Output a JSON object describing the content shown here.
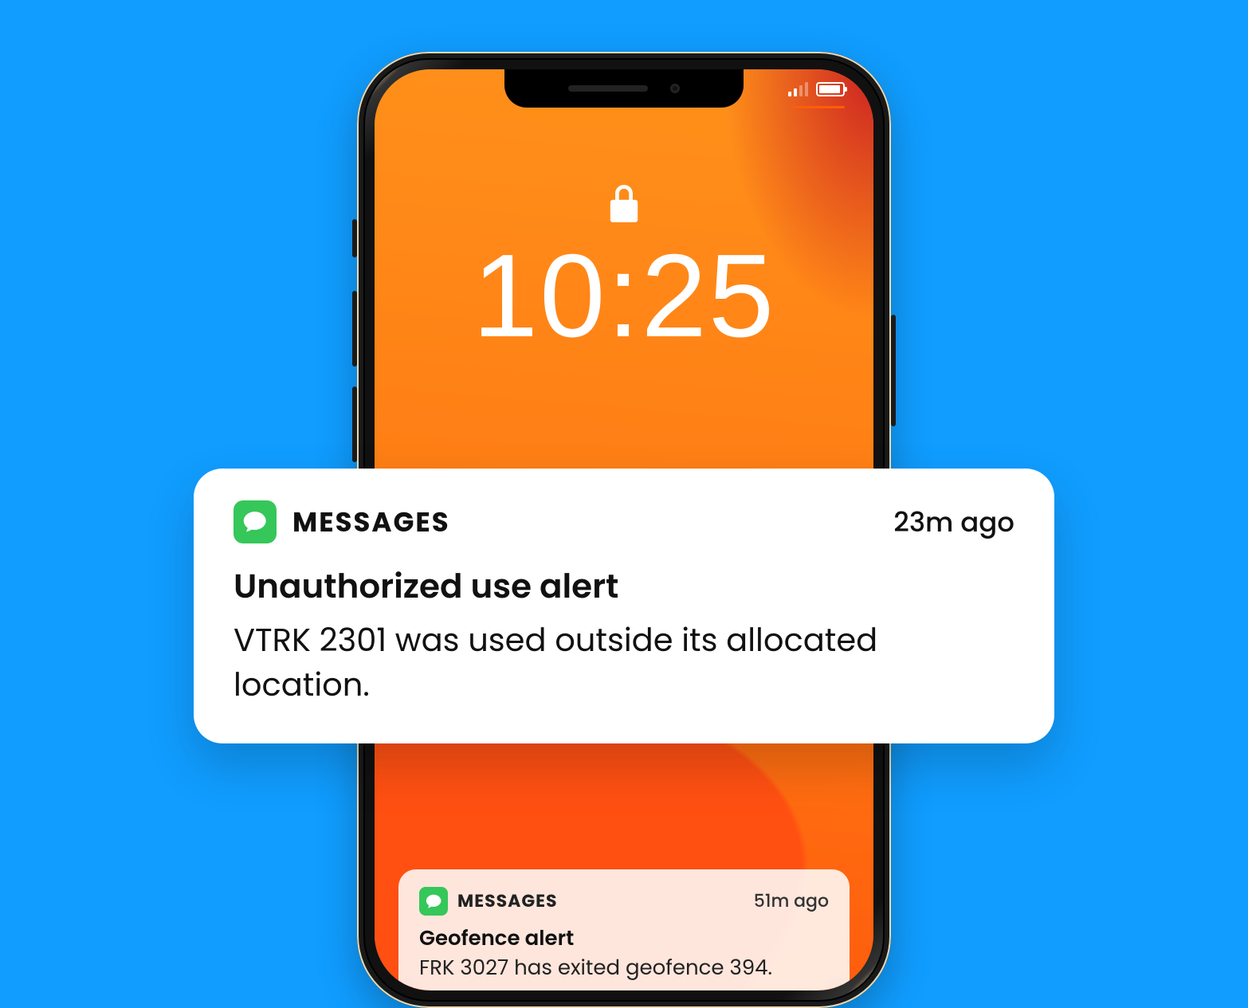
{
  "lockscreen": {
    "time": "10:25"
  },
  "notifications": {
    "primary": {
      "app_label": "MESSAGES",
      "timestamp": "23m ago",
      "title": "Unauthorized use alert",
      "body": "VTRK 2301 was used outside its allocated location."
    },
    "secondary": {
      "app_label": "MESSAGES",
      "timestamp": "51m ago",
      "title": "Geofence alert",
      "body": "FRK 3027 has exited geofence 394."
    }
  },
  "colors": {
    "background": "#109dff",
    "messages_icon": "#35c759"
  }
}
